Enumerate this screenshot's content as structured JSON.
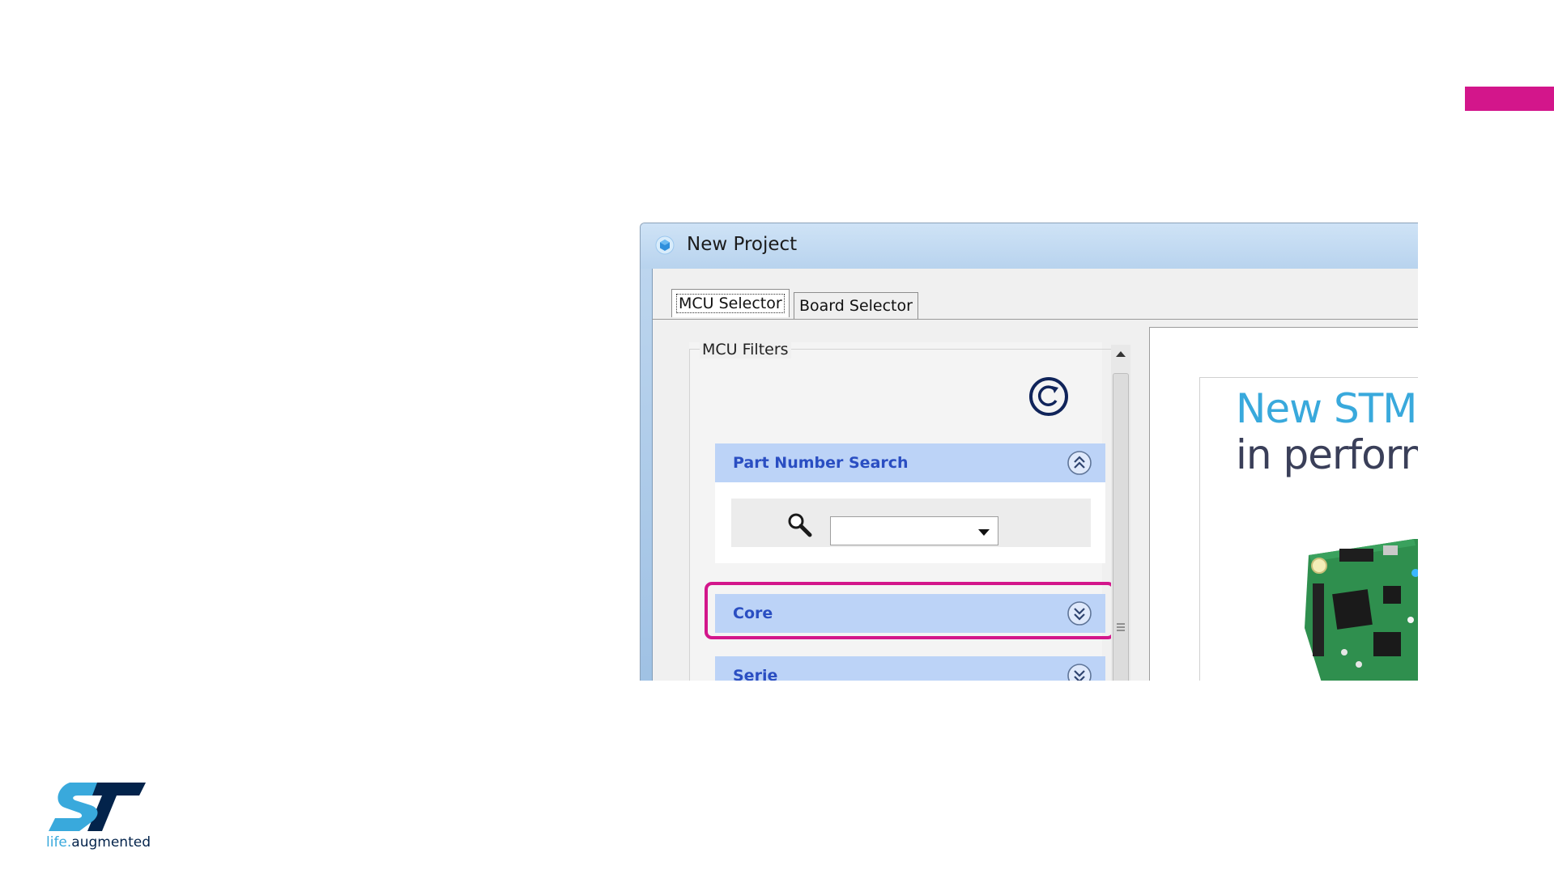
{
  "colors": {
    "accent_bar": "#d3168b",
    "highlight": "#d3168b",
    "section_header_bg": "#bcd3f7",
    "section_title": "#2a4ec2",
    "st_dark": "#03234b",
    "st_light": "#39a9dc"
  },
  "dialog": {
    "title": "New Project",
    "app_icon": "cube-icon",
    "tabs": [
      {
        "label": "MCU Selector",
        "active": true
      },
      {
        "label": "Board Selector",
        "active": false
      }
    ],
    "filters": {
      "label": "MCU Filters",
      "reset_icon": "reset-icon",
      "sections": [
        {
          "title": "Part Number Search",
          "icon": "chevron-double-up-icon",
          "expanded": true
        },
        {
          "title": "Core",
          "icon": "chevron-double-down-icon",
          "expanded": false,
          "highlighted": true
        },
        {
          "title": "Serie",
          "icon": "chevron-double-down-icon",
          "expanded": false
        }
      ],
      "search": {
        "icon": "search-icon",
        "value": ""
      }
    },
    "promo": {
      "line1": "New STM",
      "line2": "in perform",
      "image": "board-image"
    }
  },
  "logo": {
    "tagline_part1": "life.",
    "tagline_part2": "augmented"
  }
}
